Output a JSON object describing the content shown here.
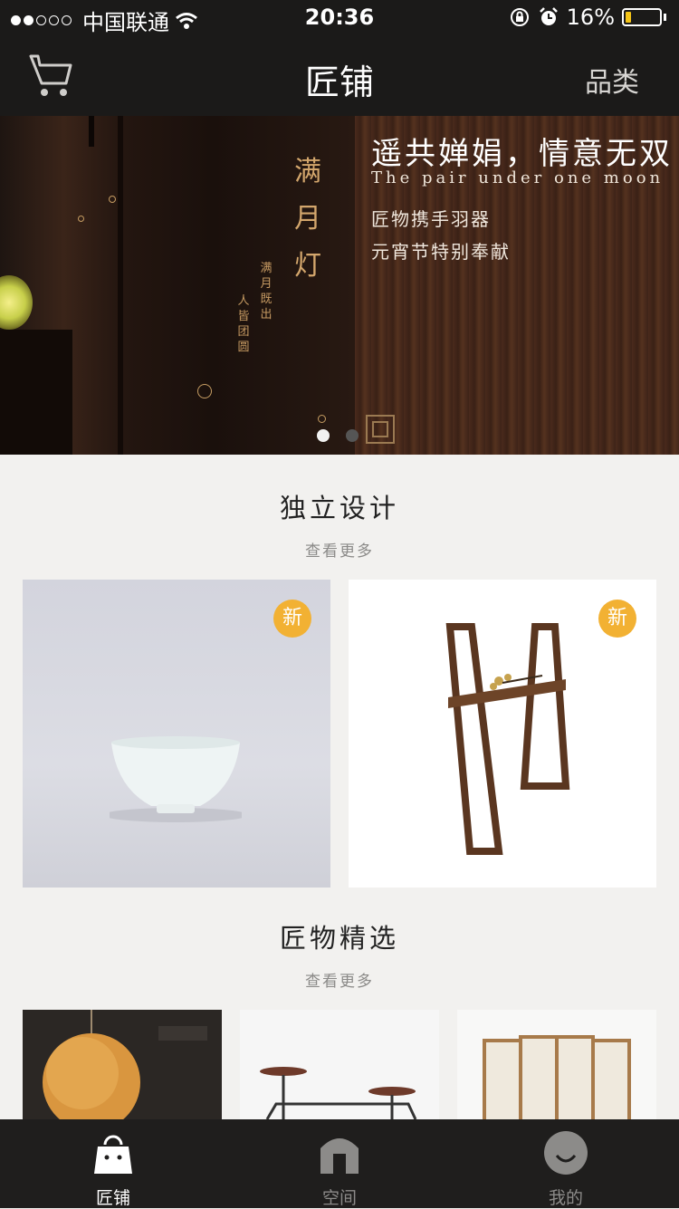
{
  "status_bar": {
    "carrier": "中国联通",
    "time": "20:36",
    "battery_text": "16%",
    "battery_level": 0.16,
    "signal_strength": 2,
    "battery_color": "#f5c518"
  },
  "nav": {
    "title": "匠铺",
    "category_label": "品类",
    "cart_icon": "cart-icon"
  },
  "banner": {
    "vertical_title": "满月灯",
    "vertical_sub_1": "满月既出",
    "vertical_sub_2": "人皆团圆",
    "heading": "遥共婵娟，情意无双",
    "heading_en": "The pair under one moon",
    "line_1": "匠物携手羽器",
    "line_2": "元宵节特别奉献",
    "dots_count": 2,
    "active_dot": 0
  },
  "sections": [
    {
      "title": "独立设计",
      "more": "查看更多",
      "items": [
        {
          "badge": "新",
          "name": "white-bowl"
        },
        {
          "badge": "新",
          "name": "wooden-stand"
        }
      ]
    },
    {
      "title": "匠物精选",
      "more": "查看更多",
      "items": [
        {
          "name": "orange-lamp"
        },
        {
          "name": "side-table"
        },
        {
          "name": "folding-screen"
        }
      ]
    }
  ],
  "tabs": [
    {
      "label": "匠铺",
      "icon": "shopping-bag-icon",
      "active": true
    },
    {
      "label": "空间",
      "icon": "house-icon",
      "active": false
    },
    {
      "label": "我的",
      "icon": "smiley-icon",
      "active": false
    }
  ],
  "colors": {
    "bar_bg": "#1b1a19",
    "accent_badge": "#f2b133",
    "page_bg": "#f2f1ef"
  }
}
